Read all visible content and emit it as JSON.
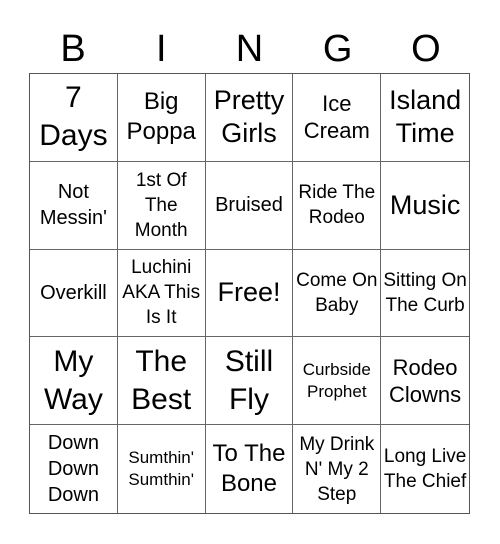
{
  "header": {
    "letters": [
      "B",
      "I",
      "N",
      "G",
      "O"
    ]
  },
  "cells": [
    {
      "text": "7 Days"
    },
    {
      "text": "Big Poppa"
    },
    {
      "text": "Pretty Girls"
    },
    {
      "text": "Ice Cream"
    },
    {
      "text": "Island Time"
    },
    {
      "text": "Not Messin'"
    },
    {
      "text": "1st Of The Month"
    },
    {
      "text": "Bruised"
    },
    {
      "text": "Ride The Rodeo"
    },
    {
      "text": "Music"
    },
    {
      "text": "Overkill"
    },
    {
      "text": "Luchini AKA This Is It"
    },
    {
      "text": "Free!"
    },
    {
      "text": "Come On Baby"
    },
    {
      "text": "Sitting On The Curb"
    },
    {
      "text": "My Way"
    },
    {
      "text": "The Best"
    },
    {
      "text": "Still Fly"
    },
    {
      "text": "Curbside Prophet"
    },
    {
      "text": "Rodeo Clowns"
    },
    {
      "text": "Down Down Down"
    },
    {
      "text": "Sumthin' Sumthin'"
    },
    {
      "text": "To The Bone"
    },
    {
      "text": "My Drink N' My 2 Step"
    },
    {
      "text": "Long Live The Chief"
    }
  ]
}
